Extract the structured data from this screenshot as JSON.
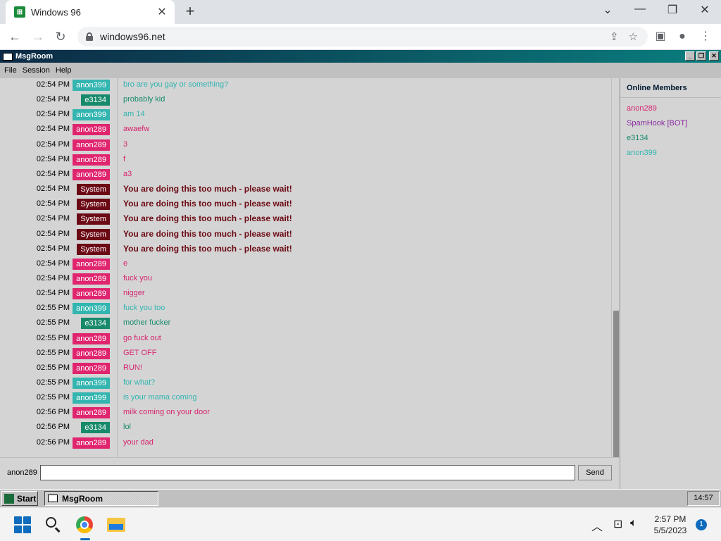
{
  "browser": {
    "tab_title": "Windows 96",
    "url": "windows96.net"
  },
  "app": {
    "title": "MsgRoom",
    "menu": [
      "File",
      "Session",
      "Help"
    ],
    "messages": [
      {
        "time": "02:54 PM",
        "user": "anon399",
        "text": "bro are you gay or something?"
      },
      {
        "time": "02:54 PM",
        "user": "e3134",
        "text": "probably kid"
      },
      {
        "time": "02:54 PM",
        "user": "anon399",
        "text": "am 14"
      },
      {
        "time": "02:54 PM",
        "user": "anon289",
        "text": "awaefw"
      },
      {
        "time": "02:54 PM",
        "user": "anon289",
        "text": "3"
      },
      {
        "time": "02:54 PM",
        "user": "anon289",
        "text": "f"
      },
      {
        "time": "02:54 PM",
        "user": "anon289",
        "text": "a3"
      },
      {
        "time": "02:54 PM",
        "user": "System",
        "text": "You are doing this too much - please wait!"
      },
      {
        "time": "02:54 PM",
        "user": "System",
        "text": "You are doing this too much - please wait!"
      },
      {
        "time": "02:54 PM",
        "user": "System",
        "text": "You are doing this too much - please wait!"
      },
      {
        "time": "02:54 PM",
        "user": "System",
        "text": "You are doing this too much - please wait!"
      },
      {
        "time": "02:54 PM",
        "user": "System",
        "text": "You are doing this too much - please wait!"
      },
      {
        "time": "02:54 PM",
        "user": "anon289",
        "text": "e"
      },
      {
        "time": "02:54 PM",
        "user": "anon289",
        "text": "fuck you"
      },
      {
        "time": "02:54 PM",
        "user": "anon289",
        "text": "nigger"
      },
      {
        "time": "02:55 PM",
        "user": "anon399",
        "text": "fuck you too"
      },
      {
        "time": "02:55 PM",
        "user": "e3134",
        "text": "mother fucker"
      },
      {
        "time": "02:55 PM",
        "user": "anon289",
        "text": "go fuck out"
      },
      {
        "time": "02:55 PM",
        "user": "anon289",
        "text": "GET OFF"
      },
      {
        "time": "02:55 PM",
        "user": "anon289",
        "text": "RUN!"
      },
      {
        "time": "02:55 PM",
        "user": "anon399",
        "text": "for what?"
      },
      {
        "time": "02:55 PM",
        "user": "anon399",
        "text": "is your mama coming"
      },
      {
        "time": "02:56 PM",
        "user": "anon289",
        "text": "milk coming on your door"
      },
      {
        "time": "02:56 PM",
        "user": "e3134",
        "text": "lol"
      },
      {
        "time": "02:56 PM",
        "user": "anon289",
        "text": "your dad"
      }
    ],
    "members_title": "Online Members",
    "members": [
      {
        "name": "anon289",
        "color": "#d6246e"
      },
      {
        "name": "SpamHook [BOT]",
        "color": "#8a2ba0"
      },
      {
        "name": "e3134",
        "color": "#178a6c"
      },
      {
        "name": "anon399",
        "color": "#33b5b0"
      }
    ],
    "nickname": "anon289",
    "input_value": "",
    "send_label": "Send"
  },
  "user_colors": {
    "anon399": {
      "bg": "#33b5b0",
      "text": "#33b5b0"
    },
    "e3134": {
      "bg": "#178a6c",
      "text": "#178a6c"
    },
    "anon289": {
      "bg": "#e0246e",
      "text": "#d6246e"
    },
    "System": {
      "bg": "#6b0a14",
      "text": "#6b0a14"
    }
  },
  "taskbar96": {
    "start_label": "Start",
    "task_label": "MsgRoom",
    "clock": "14:57"
  },
  "windows_taskbar": {
    "time": "2:57 PM",
    "date": "5/5/2023",
    "notifications": "1"
  }
}
